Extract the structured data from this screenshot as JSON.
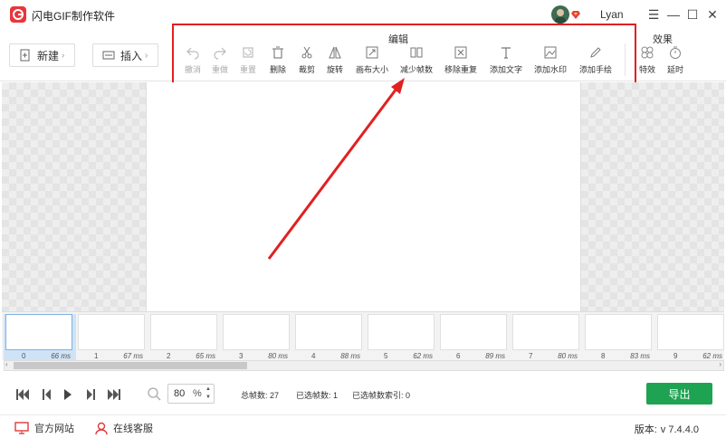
{
  "app": {
    "title": "闪电GIF制作软件",
    "username": "Lyan"
  },
  "window": {
    "menu": "☰",
    "minimize": "—",
    "maximize": "☐",
    "close": "✕"
  },
  "toolbar": {
    "new_label": "新建",
    "insert_label": "插入",
    "edit_group": "编辑",
    "effect_group": "效果",
    "edit_tools": [
      {
        "label": "撤消",
        "icon": "undo-icon",
        "enabled": false
      },
      {
        "label": "重做",
        "icon": "redo-icon",
        "enabled": false
      },
      {
        "label": "重置",
        "icon": "reset-icon",
        "enabled": false
      },
      {
        "label": "删除",
        "icon": "trash-icon",
        "enabled": true
      },
      {
        "label": "裁剪",
        "icon": "scissors-icon",
        "enabled": true
      },
      {
        "label": "旋转",
        "icon": "rotate-icon",
        "enabled": true
      },
      {
        "label": "画布大小",
        "icon": "resize-icon",
        "enabled": true
      },
      {
        "label": "减少帧数",
        "icon": "reduce-frames-icon",
        "enabled": true
      },
      {
        "label": "移除重复",
        "icon": "remove-duplicate-icon",
        "enabled": true
      },
      {
        "label": "添加文字",
        "icon": "text-icon",
        "enabled": true
      },
      {
        "label": "添加水印",
        "icon": "watermark-icon",
        "enabled": true
      },
      {
        "label": "添加手绘",
        "icon": "pencil-icon",
        "enabled": true
      }
    ],
    "effect_tools": [
      {
        "label": "特效",
        "icon": "effects-icon"
      },
      {
        "label": "延时",
        "icon": "timer-icon"
      }
    ]
  },
  "frames": [
    {
      "index": "0",
      "ms": "66 ms"
    },
    {
      "index": "1",
      "ms": "67 ms"
    },
    {
      "index": "2",
      "ms": "65 ms"
    },
    {
      "index": "3",
      "ms": "80 ms"
    },
    {
      "index": "4",
      "ms": "88 ms"
    },
    {
      "index": "5",
      "ms": "62 ms"
    },
    {
      "index": "6",
      "ms": "89 ms"
    },
    {
      "index": "7",
      "ms": "80 ms"
    },
    {
      "index": "8",
      "ms": "83 ms"
    },
    {
      "index": "9",
      "ms": "62 ms"
    }
  ],
  "selected_frame": 0,
  "playback": {
    "zoom_value": "80",
    "zoom_unit": "%",
    "total_frames_label": "总帧数: 27",
    "selected_frames_label": "已选帧数: 1",
    "selected_index_label": "已选帧数索引: 0",
    "export_label": "导出"
  },
  "status": {
    "website_label": "官方网站",
    "support_label": "在线客服",
    "version_label": "版本:",
    "version_value": "v 7.4.4.0"
  }
}
